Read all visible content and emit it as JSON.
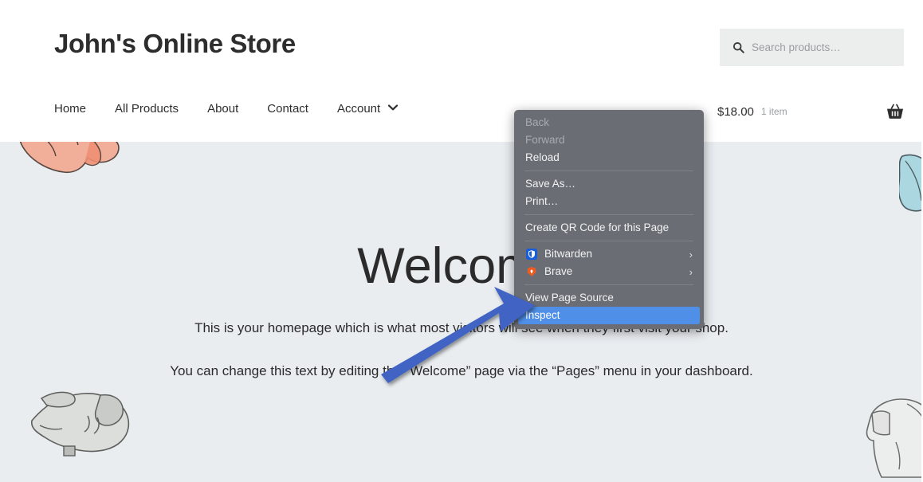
{
  "site": {
    "title": "John's Online Store",
    "nav": [
      {
        "label": "Home"
      },
      {
        "label": "All Products"
      },
      {
        "label": "About"
      },
      {
        "label": "Contact"
      },
      {
        "label": "Account"
      }
    ],
    "account_caret_icon": "chevron-down-icon",
    "search": {
      "icon": "search-icon",
      "placeholder": "Search products…",
      "value": ""
    },
    "cart": {
      "total": "$18.00",
      "count": "1 item",
      "icon": "shopping-basket-icon"
    }
  },
  "main": {
    "heading": "Welcome",
    "paragraph_1": "This is your homepage which is what most visitors will see when they first visit your shop.",
    "paragraph_2": "You can change this text by editing the “Welcome” page via the “Pages” menu in your dashboard."
  },
  "context_menu": {
    "items": [
      {
        "label": "Back",
        "disabled": true,
        "highlighted": false,
        "submenu": false,
        "icon": null
      },
      {
        "label": "Forward",
        "disabled": true,
        "highlighted": false,
        "submenu": false,
        "icon": null
      },
      {
        "label": "Reload",
        "disabled": false,
        "highlighted": false,
        "submenu": false,
        "icon": null
      },
      {
        "separator": true
      },
      {
        "label": "Save As…",
        "disabled": false,
        "highlighted": false,
        "submenu": false,
        "icon": null
      },
      {
        "label": "Print…",
        "disabled": false,
        "highlighted": false,
        "submenu": false,
        "icon": null
      },
      {
        "separator": true
      },
      {
        "label": "Create QR Code for this Page",
        "disabled": false,
        "highlighted": false,
        "submenu": false,
        "icon": null
      },
      {
        "separator": true
      },
      {
        "label": "Bitwarden",
        "disabled": false,
        "highlighted": false,
        "submenu": true,
        "icon": "bitwarden-shield-icon"
      },
      {
        "label": "Brave",
        "disabled": false,
        "highlighted": false,
        "submenu": true,
        "icon": "brave-lion-icon"
      },
      {
        "separator": true
      },
      {
        "label": "View Page Source",
        "disabled": false,
        "highlighted": false,
        "submenu": false,
        "icon": null
      },
      {
        "label": "Inspect",
        "disabled": false,
        "highlighted": true,
        "submenu": false,
        "icon": null
      }
    ],
    "submenu_arrow_glyph": "›"
  },
  "annotation": {
    "arrow_color": "#3f63c4",
    "points_to": "Inspect"
  },
  "colors": {
    "page_background": "#e9edf0",
    "header_background": "#ffffff",
    "menu_background": "#6a6e74",
    "menu_highlight": "#4f8fe8",
    "text": "#2b2b2b",
    "muted_text": "#9a9ea1",
    "search_field": "#eceded"
  },
  "decorations": [
    {
      "name": "salmon-garment",
      "color": "#f0a08c"
    },
    {
      "name": "grey-hoodie",
      "color": "#d5d6d4"
    },
    {
      "name": "blue-garment",
      "color": "#a7d5e0"
    },
    {
      "name": "white-tshirt",
      "color": "#ececed"
    }
  ]
}
